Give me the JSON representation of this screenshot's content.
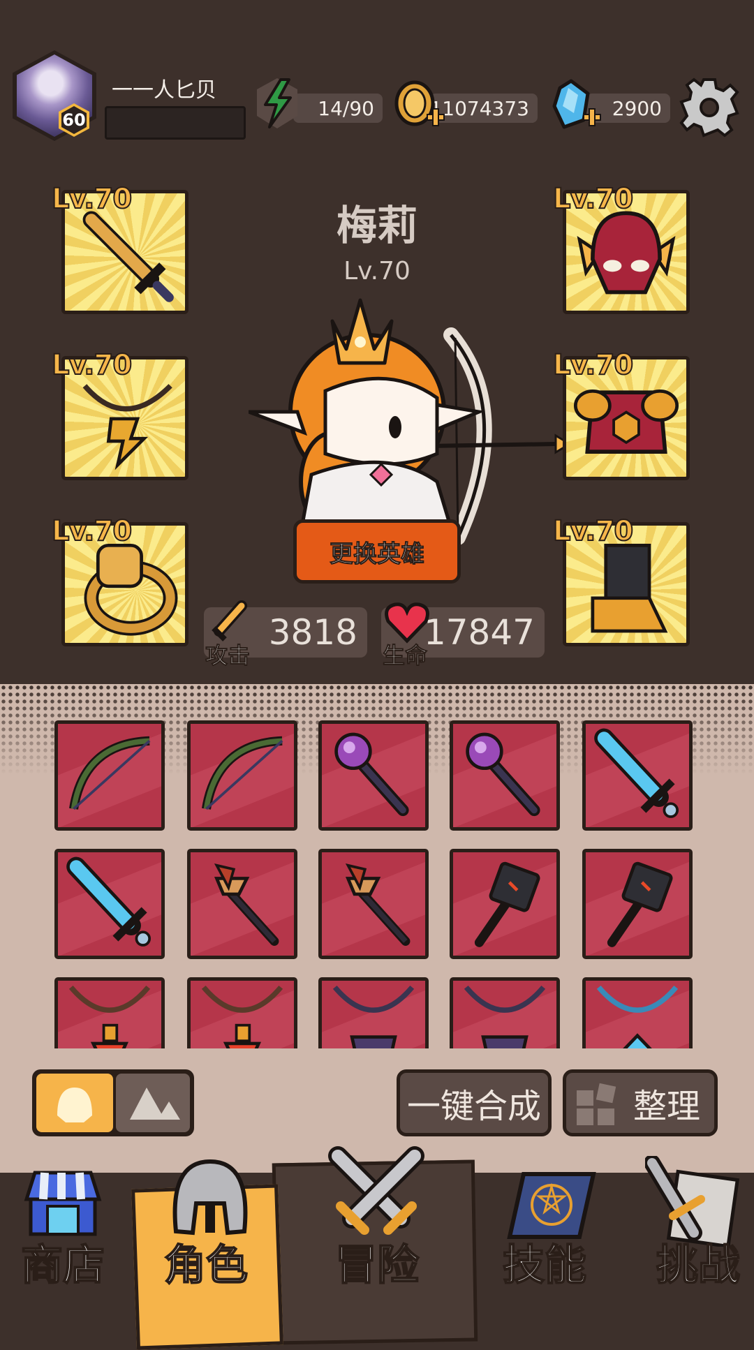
{
  "player": {
    "name": "一一人匕贝",
    "level": "60"
  },
  "resources": {
    "energy": "14/90",
    "gold": "11074373",
    "gems": "2900"
  },
  "hero": {
    "name": "梅莉",
    "level": "Lv.70",
    "change_label": "更换英雄"
  },
  "equipment": {
    "weapon": "Lv.70",
    "necklace": "Lv.70",
    "ring": "Lv.70",
    "helmet": "Lv.70",
    "armor": "Lv.70",
    "boots": "Lv.70"
  },
  "stats": {
    "attack_label": "攻击",
    "attack_value": "3818",
    "hp_label": "生命",
    "hp_value": "17847"
  },
  "inventory": [
    "vine-bow",
    "vine-bow",
    "orb-staff",
    "orb-staff",
    "ice-sword",
    "ice-sword",
    "bone-dagger",
    "bone-dagger",
    "war-hammer",
    "war-hammer",
    "fang-necklace",
    "fang-necklace",
    "dark-necklace",
    "dark-necklace",
    "blue-necklace"
  ],
  "controls": {
    "merge_label": "一键合成",
    "sort_label": "整理"
  },
  "nav": {
    "shop": "商店",
    "hero": "角色",
    "adventure": "冒险",
    "skills": "技能",
    "challenge": "挑战"
  },
  "colors": {
    "background": "#3d302b",
    "accent": "#f6b44a",
    "item_bg": "#b5364a",
    "button": "#e45a17"
  }
}
